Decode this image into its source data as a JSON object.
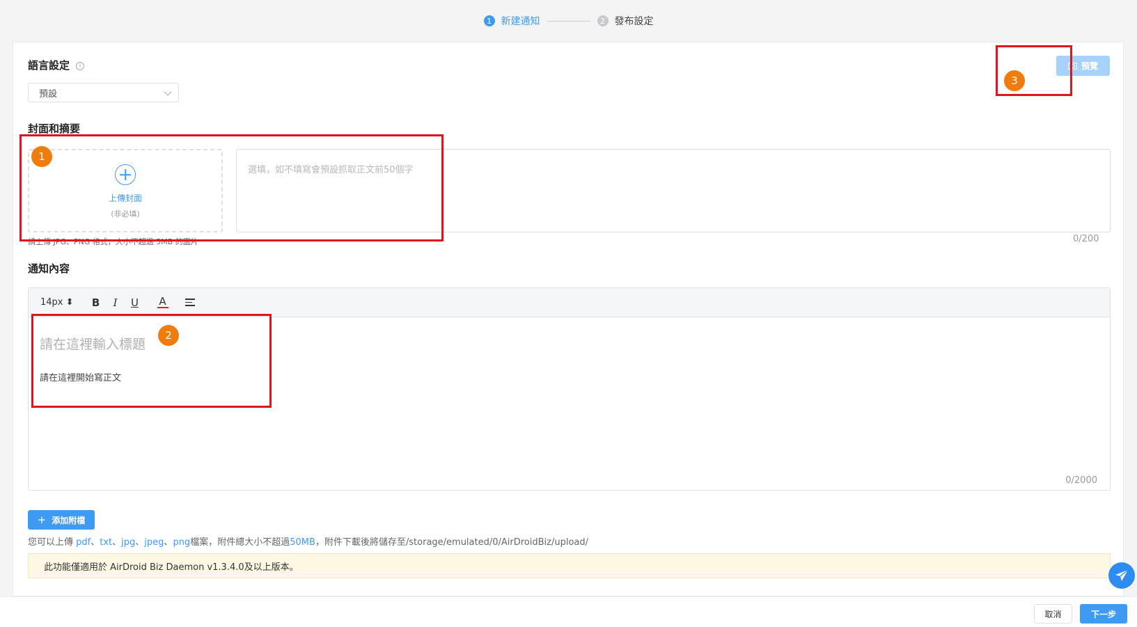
{
  "stepper": {
    "steps": [
      {
        "num": "1",
        "label": "新建通知",
        "state": "active"
      },
      {
        "num": "2",
        "label": "發布設定",
        "state": "inactive"
      }
    ]
  },
  "language": {
    "title": "語言設定",
    "info_icon": "i",
    "selected": "預設"
  },
  "preview": {
    "label": "預覽"
  },
  "cover": {
    "title": "封面和摘要",
    "upload_label": "上傳封面",
    "upload_sub": "(非必填)",
    "upload_hint": "請上傳 JPG、PNG 格式，大小不超過 5MB 的圖片",
    "summary_placeholder": "選填，如不填寫會預設抓取正文前50個字",
    "summary_count": "0/200"
  },
  "content": {
    "title": "通知內容",
    "font_size": "14px",
    "bold": "B",
    "italic": "I",
    "underline": "U",
    "color": "A",
    "title_placeholder": "請在這裡輸入標題",
    "body_placeholder": "請在這裡開始寫正文",
    "count": "0/2000"
  },
  "attachment": {
    "button_label": "添加附檔",
    "hint_prefix": "您可以上傳 ",
    "types": [
      "pdf",
      "txt",
      "jpg",
      "jpeg",
      "png"
    ],
    "sep": "、",
    "hint_mid": "檔案，附件總大小不超過",
    "size": "50MB",
    "hint_suffix": "，附件下載後將儲存至/storage/emulated/0/AirDroidBiz/upload/"
  },
  "notice": {
    "text": "此功能僅適用於 AirDroid Biz Daemon v1.3.4.0及以上版本。"
  },
  "annotations": [
    "1",
    "2",
    "3"
  ],
  "footer": {
    "cancel": "取消",
    "next": "下一步"
  },
  "colors": {
    "accent": "#3f9af3",
    "annotation_box": "#e0141c",
    "annotation_badge": "#f07c0e"
  }
}
